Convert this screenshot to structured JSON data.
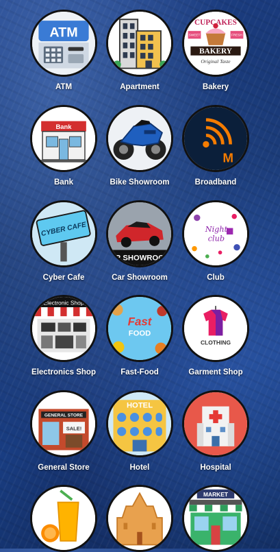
{
  "categories": [
    {
      "label": "ATM",
      "icon": "atm-icon"
    },
    {
      "label": "Apartment",
      "icon": "apartment-icon"
    },
    {
      "label": "Bakery",
      "icon": "bakery-icon",
      "sign_top": "CUPCAKES",
      "sign_mid": "BAKERY",
      "sign_bottom": "Original Taste",
      "sign_left": "SWEET",
      "sign_right": "FRESH"
    },
    {
      "label": "Bank",
      "icon": "bank-icon",
      "sign": "Bank"
    },
    {
      "label": "Bike Showroom",
      "icon": "motorbike-icon"
    },
    {
      "label": "Broadband",
      "icon": "wifi-icon"
    },
    {
      "label": "Cyber Cafe",
      "icon": "cyber-cafe-sign-icon",
      "sign": "CYBER CAFE"
    },
    {
      "label": "Car Showroom",
      "icon": "sports-car-icon",
      "sign": "R SHOWROO"
    },
    {
      "label": "Club",
      "icon": "night-club-icon",
      "sign": "Night club"
    },
    {
      "label": "Electronics Shop",
      "icon": "electronics-store-icon",
      "sign": "Electronic Shop"
    },
    {
      "label": "Fast-Food",
      "icon": "fast-food-icon",
      "sign_top": "Fast",
      "sign_bottom": "FOOD"
    },
    {
      "label": "Garment Shop",
      "icon": "clothing-icon",
      "sign": "CLOTHING"
    },
    {
      "label": "General Store",
      "icon": "general-store-icon",
      "sign": "GENERAL STORE",
      "sign_sale": "SALE!"
    },
    {
      "label": "Hotel",
      "icon": "hotel-icon",
      "sign": "HOTEL"
    },
    {
      "label": "Hospital",
      "icon": "hospital-icon"
    },
    {
      "label": "",
      "icon": "juice-icon"
    },
    {
      "label": "",
      "icon": "temple-icon"
    },
    {
      "label": "",
      "icon": "market-icon",
      "sign": "MARKET"
    }
  ],
  "colors": {
    "label": "#ffffff",
    "circle_border": "#111111",
    "background": "#1b3f85"
  }
}
